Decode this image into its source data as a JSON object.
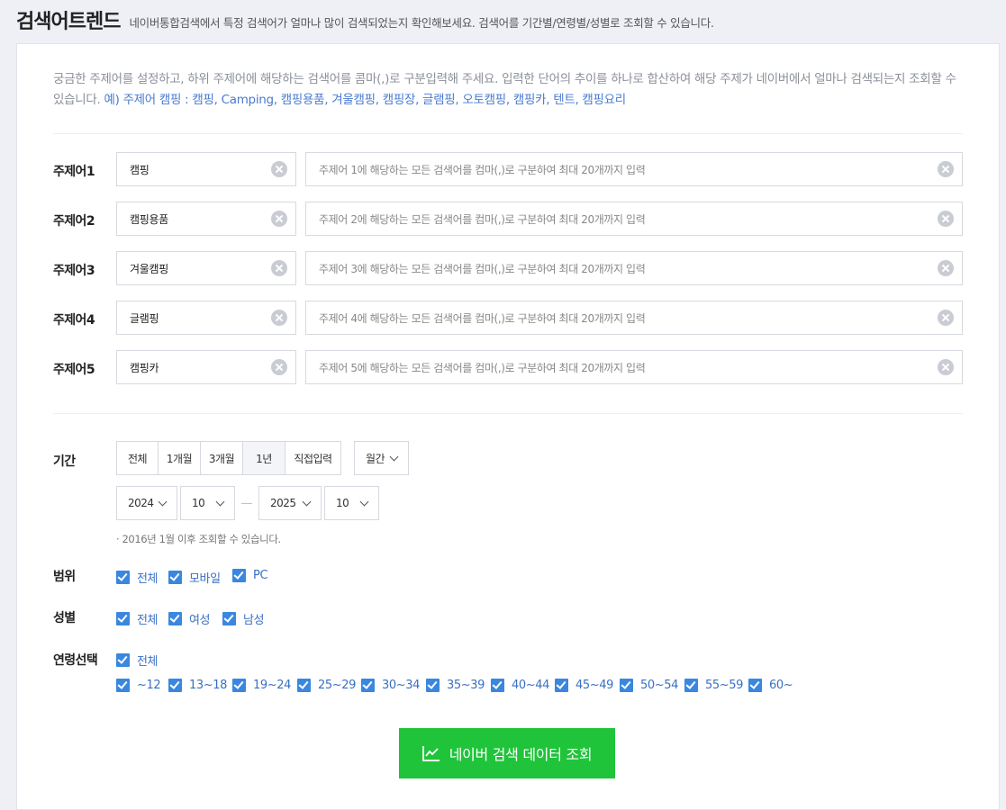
{
  "header": {
    "title": "검색어트렌드",
    "description": "네이버통합검색에서 특정 검색어가 얼마나 많이 검색되었는지 확인해보세요. 검색어를 기간별/연령별/성별로 조회할 수 있습니다."
  },
  "intro": {
    "text": "궁금한 주제어를 설정하고, 하위 주제어에 해당하는 검색어를 콤마(,)로 구분입력해 주세요. 입력한 단어의 추이를 하나로 합산하여 해당 주제가 네이버에서 얼마나 검색되는지 조회할 수 있습니다.",
    "example": "예) 주제어 캠핑 : 캠핑, Camping, 캠핑용품, 겨울캠핑, 캠핑장, 글램핑, 오토캠핑, 캠핑카, 텐트, 캠핑요리"
  },
  "topics": [
    {
      "label": "주제어1",
      "value": "캠핑",
      "placeholder": "주제어 1에 해당하는 모든 검색어를 컴마(,)로 구분하여 최대 20개까지 입력"
    },
    {
      "label": "주제어2",
      "value": "캠핑용품",
      "placeholder": "주제어 2에 해당하는 모든 검색어를 컴마(,)로 구분하여 최대 20개까지 입력"
    },
    {
      "label": "주제어3",
      "value": "겨울캠핑",
      "placeholder": "주제어 3에 해당하는 모든 검색어를 컴마(,)로 구분하여 최대 20개까지 입력"
    },
    {
      "label": "주제어4",
      "value": "글램핑",
      "placeholder": "주제어 4에 해당하는 모든 검색어를 컴마(,)로 구분하여 최대 20개까지 입력"
    },
    {
      "label": "주제어5",
      "value": "캠핑카",
      "placeholder": "주제어 5에 해당하는 모든 검색어를 컴마(,)로 구분하여 최대 20개까지 입력"
    }
  ],
  "period": {
    "label": "기간",
    "options": [
      "전체",
      "1개월",
      "3개월",
      "1년",
      "직접입력"
    ],
    "selected": "1년",
    "interval": "월간",
    "start_year": "2024",
    "start_month": "10",
    "end_year": "2025",
    "end_month": "10",
    "note": "· 2016년 1월 이후 조회할 수 있습니다."
  },
  "scope": {
    "label": "범위",
    "options": [
      "전체",
      "모바일",
      "PC"
    ]
  },
  "gender": {
    "label": "성별",
    "options": [
      "전체",
      "여성",
      "남성"
    ]
  },
  "age": {
    "label": "연령선택",
    "all": "전체",
    "options": [
      "~12",
      "13~18",
      "19~24",
      "25~29",
      "30~34",
      "35~39",
      "40~44",
      "45~49",
      "50~54",
      "55~59",
      "60~"
    ]
  },
  "search_button": {
    "label": "네이버 검색 데이터 조회",
    "icon": "chart-line-icon"
  },
  "colors": {
    "accent": "#20c43a",
    "checkbox": "#3a87e0",
    "link": "#3a6fc4"
  }
}
